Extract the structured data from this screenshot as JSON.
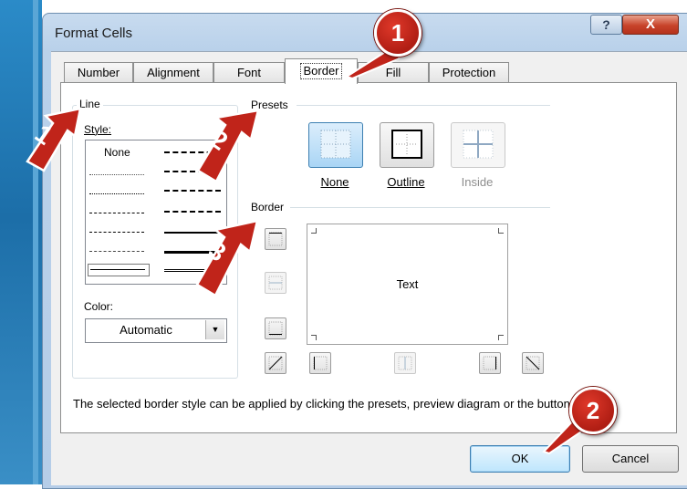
{
  "window": {
    "title": "Format Cells",
    "help_label": "?",
    "close_label": "X"
  },
  "tabs": [
    "Number",
    "Alignment",
    "Font",
    "Border",
    "Fill",
    "Protection"
  ],
  "line_group": {
    "title": "Line",
    "style_label": "Style:",
    "style_none": "None",
    "color_label": "Color:",
    "color_value": "Automatic"
  },
  "presets_group": {
    "title": "Presets",
    "items": [
      {
        "label": "None",
        "state": "selected"
      },
      {
        "label": "Outline",
        "state": "normal"
      },
      {
        "label": "Inside",
        "state": "disabled"
      }
    ]
  },
  "border_group": {
    "title": "Border",
    "preview_text": "Text"
  },
  "info_text": "The selected border style can be applied by clicking the presets, preview diagram or the buttons above.",
  "buttons": {
    "ok": "OK",
    "cancel": "Cancel"
  },
  "callouts": {
    "tab_step": "1",
    "line_step": "1",
    "preset_step": "2",
    "border_step": "3",
    "ok_step": "2"
  },
  "colors": {
    "callout_red": "#c0241a",
    "title_bar": "#b9d1ea",
    "accent_blue": "#3c7fb1"
  }
}
